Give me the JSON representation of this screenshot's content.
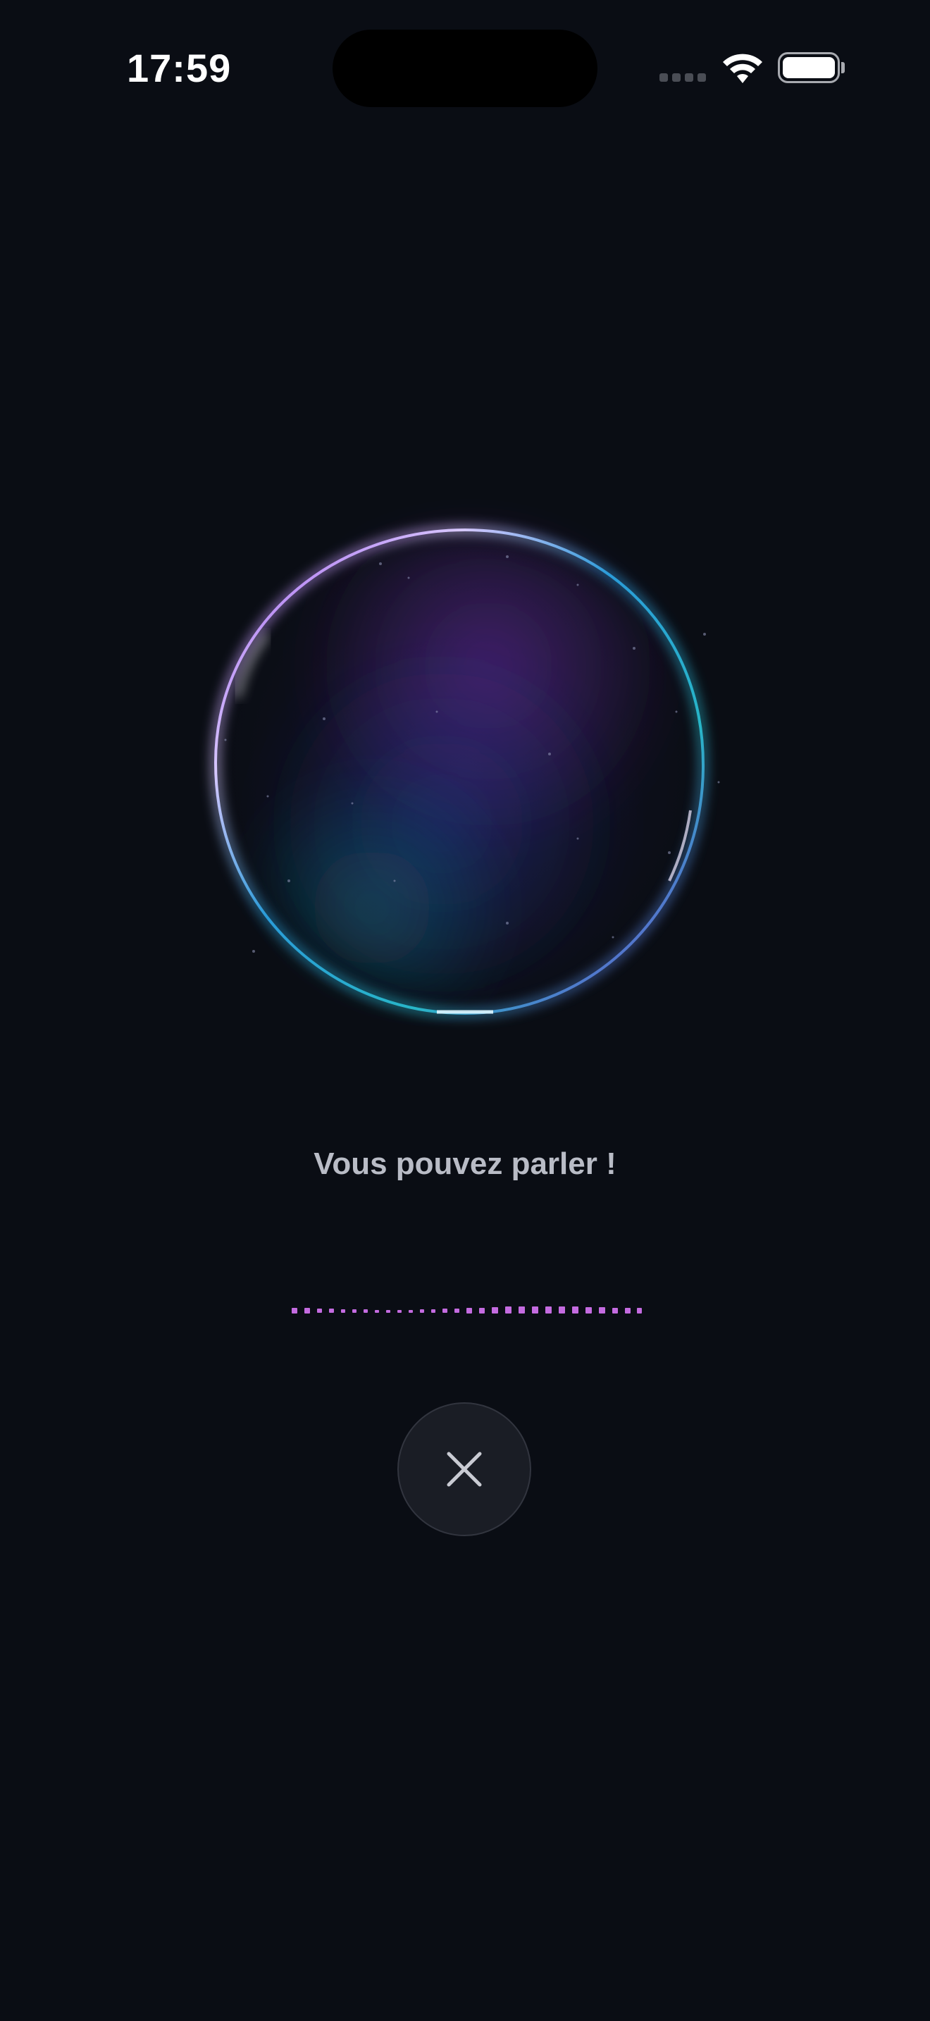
{
  "status_bar": {
    "time": "17:59",
    "icons": [
      "cellular-signal-icon",
      "wifi-icon",
      "battery-icon"
    ]
  },
  "voice": {
    "prompt": "Vous pouvez parler !",
    "close_icon": "close-icon"
  },
  "colors": {
    "background": "#0a0d14",
    "accent_purple": "#c46be0",
    "orb_blue": "#2a9bd8",
    "orb_violet": "#7a3ad0",
    "text_muted": "#b9bcc6"
  }
}
